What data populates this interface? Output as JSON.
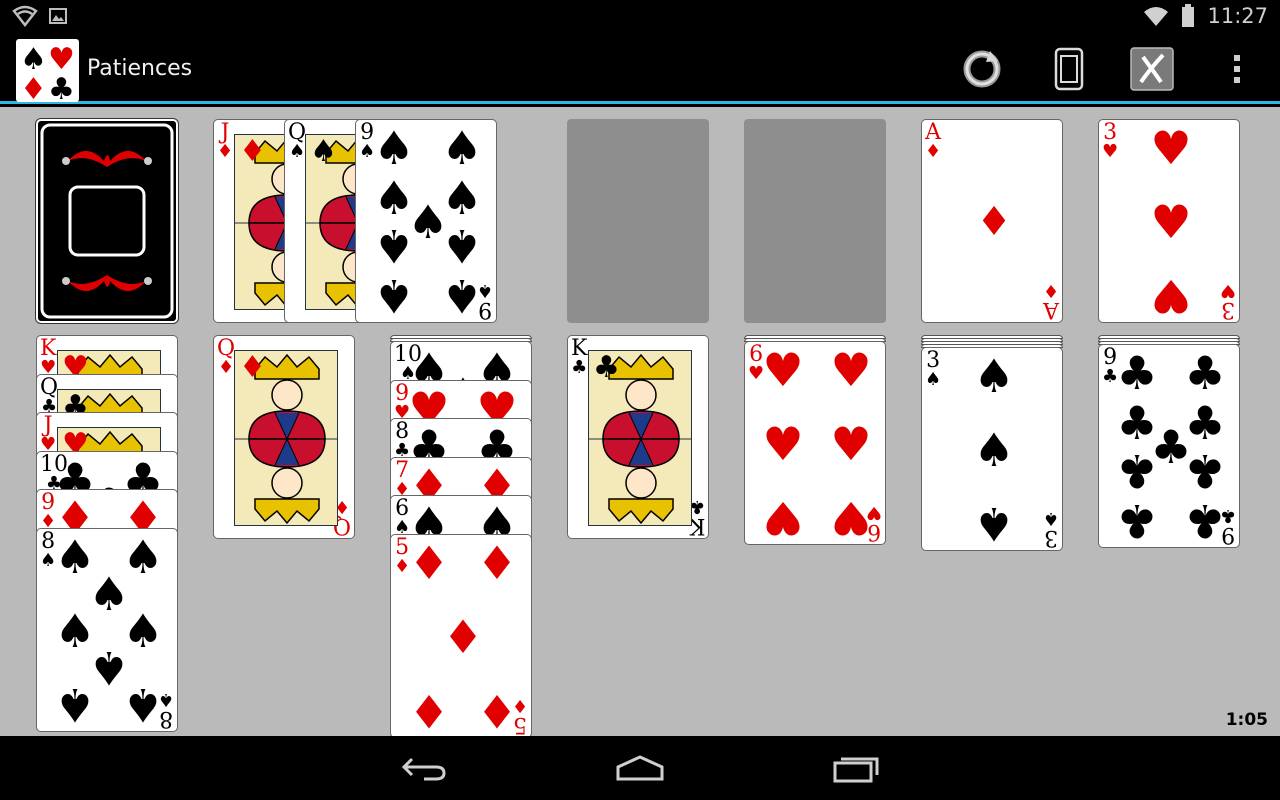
{
  "status_bar": {
    "time": "11:27",
    "left_icons": [
      "signal-shield-icon",
      "image-icon"
    ],
    "right_icons": [
      "wifi-icon",
      "battery-icon"
    ]
  },
  "action_bar": {
    "title": "Patiences",
    "actions": [
      "restart-icon",
      "rotate-device-icon",
      "cancel-icon",
      "overflow-menu-icon"
    ],
    "accent_color": "#33b5e5"
  },
  "game": {
    "timer": "1:05",
    "stock": {
      "face_down": true
    },
    "waste": [
      {
        "rank": "J",
        "suit": "♦",
        "color": "red"
      },
      {
        "rank": "Q",
        "suit": "♠",
        "color": "black"
      },
      {
        "rank": "9",
        "suit": "♠",
        "color": "black"
      }
    ],
    "foundations": [
      {
        "empty": true
      },
      {
        "empty": true
      },
      {
        "rank": "A",
        "suit": "♦",
        "color": "red"
      },
      {
        "rank": "3",
        "suit": "♥",
        "color": "red"
      }
    ],
    "tableau": [
      {
        "cards": [
          {
            "rank": "K",
            "suit": "♥",
            "color": "red"
          },
          {
            "rank": "Q",
            "suit": "♣",
            "color": "black"
          },
          {
            "rank": "J",
            "suit": "♥",
            "color": "red"
          },
          {
            "rank": "10",
            "suit": "♣",
            "color": "black"
          },
          {
            "rank": "9",
            "suit": "♦",
            "color": "red"
          },
          {
            "rank": "8",
            "suit": "♠",
            "color": "black"
          }
        ]
      },
      {
        "cards": [
          {
            "rank": "Q",
            "suit": "♦",
            "color": "red"
          }
        ]
      },
      {
        "cards": [
          {
            "rank": "10",
            "suit": "♠",
            "color": "black"
          },
          {
            "rank": "9",
            "suit": "♥",
            "color": "red"
          },
          {
            "rank": "8",
            "suit": "♣",
            "color": "black"
          },
          {
            "rank": "7",
            "suit": "♦",
            "color": "red"
          },
          {
            "rank": "6",
            "suit": "♠",
            "color": "black"
          },
          {
            "rank": "5",
            "suit": "♦",
            "color": "red"
          }
        ]
      },
      {
        "cards": [
          {
            "rank": "K",
            "suit": "♣",
            "color": "black"
          }
        ]
      },
      {
        "cards": [
          {
            "rank": "6",
            "suit": "♥",
            "color": "red"
          }
        ]
      },
      {
        "cards": [
          {
            "rank": "3",
            "suit": "♠",
            "color": "black"
          }
        ]
      },
      {
        "cards": [
          {
            "rank": "9",
            "suit": "♣",
            "color": "black"
          }
        ]
      }
    ]
  },
  "nav_bar": {
    "buttons": [
      "back-icon",
      "home-icon",
      "recent-apps-icon"
    ]
  }
}
